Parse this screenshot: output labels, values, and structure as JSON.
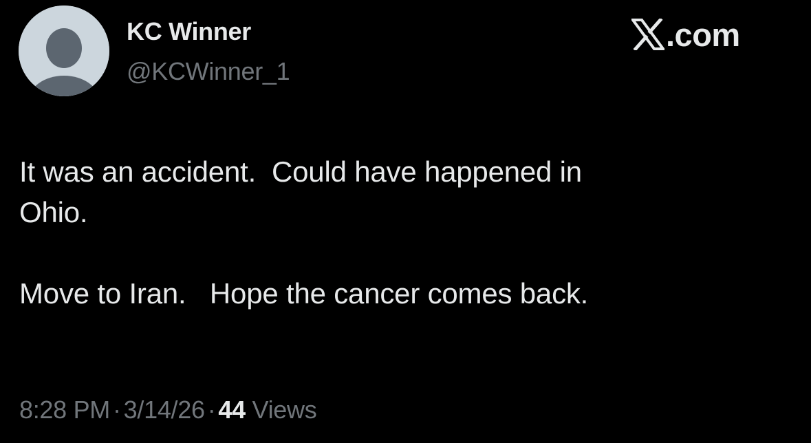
{
  "author": {
    "display_name": "KC Winner",
    "handle": "@KCWinner_1",
    "avatar_icon": "default-profile-avatar-icon"
  },
  "brand": {
    "logo_icon": "x-logo-icon",
    "domain_suffix": ".com"
  },
  "tweet": {
    "line_1": "It was an accident.  Could have happened in",
    "line_2": "Ohio.",
    "line_3": "Move to Iran.   Hope the cancer comes back."
  },
  "meta": {
    "time": "8:28 PM",
    "separator": "·",
    "date": "3/14/26",
    "views_count": "44",
    "views_label": "Views"
  },
  "colors": {
    "background": "#000000",
    "primary_text": "#e7e9ea",
    "secondary_text": "#71767b",
    "avatar_bg": "#ccd6dd",
    "avatar_figure": "#5c6670"
  }
}
